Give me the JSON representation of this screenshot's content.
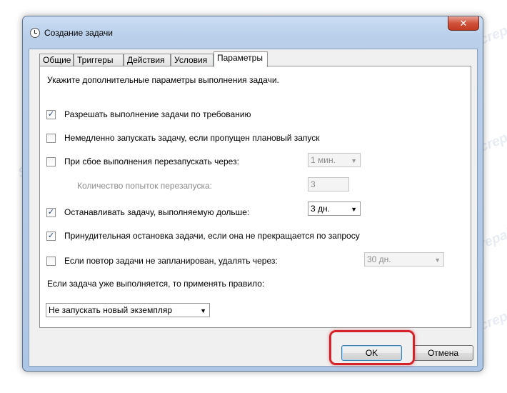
{
  "window": {
    "title": "Создание задачи",
    "close_glyph": "✕",
    "title_icon": "clock-icon"
  },
  "tabs": [
    {
      "label": "Общие"
    },
    {
      "label": "Триггеры"
    },
    {
      "label": "Действия"
    },
    {
      "label": "Условия"
    },
    {
      "label": "Параметры"
    }
  ],
  "active_tab": "Параметры",
  "settings": {
    "intro": "Укажите дополнительные параметры выполнения задачи.",
    "allow_on_demand": {
      "label": "Разрешать выполнение задачи по требованию",
      "checked": true
    },
    "run_asap_missed": {
      "label": "Немедленно запускать задачу, если пропущен плановый запуск",
      "checked": false
    },
    "restart_on_fail": {
      "label": "При сбое выполнения перезапускать через:",
      "checked": false,
      "value": "1 мин."
    },
    "restart_attempts": {
      "label": "Количество попыток перезапуска:",
      "value": "3"
    },
    "stop_if_longer": {
      "label": "Останавливать задачу, выполняемую дольше:",
      "checked": true,
      "value": "3 дн."
    },
    "force_stop": {
      "label": "Принудительная остановка задачи, если она не прекращается по запросу",
      "checked": true
    },
    "delete_if_not_scheduled": {
      "label": "Если повтор задачи не запланирован, удалять через:",
      "checked": false,
      "value": "30 дн."
    },
    "running_rule_label": "Если задача уже выполняется, то применять правило:",
    "running_rule_value": "Не запускать новый экземпляр"
  },
  "check_glyph": "✓",
  "arrow_glyph": "▼",
  "buttons": {
    "ok": "OK",
    "cancel": "Отмена"
  },
  "watermark": "Soringpcrepair.com",
  "colors": {
    "highlight": "#d4232b",
    "close_button": "#c94a33",
    "frame": "#b9cfea"
  }
}
